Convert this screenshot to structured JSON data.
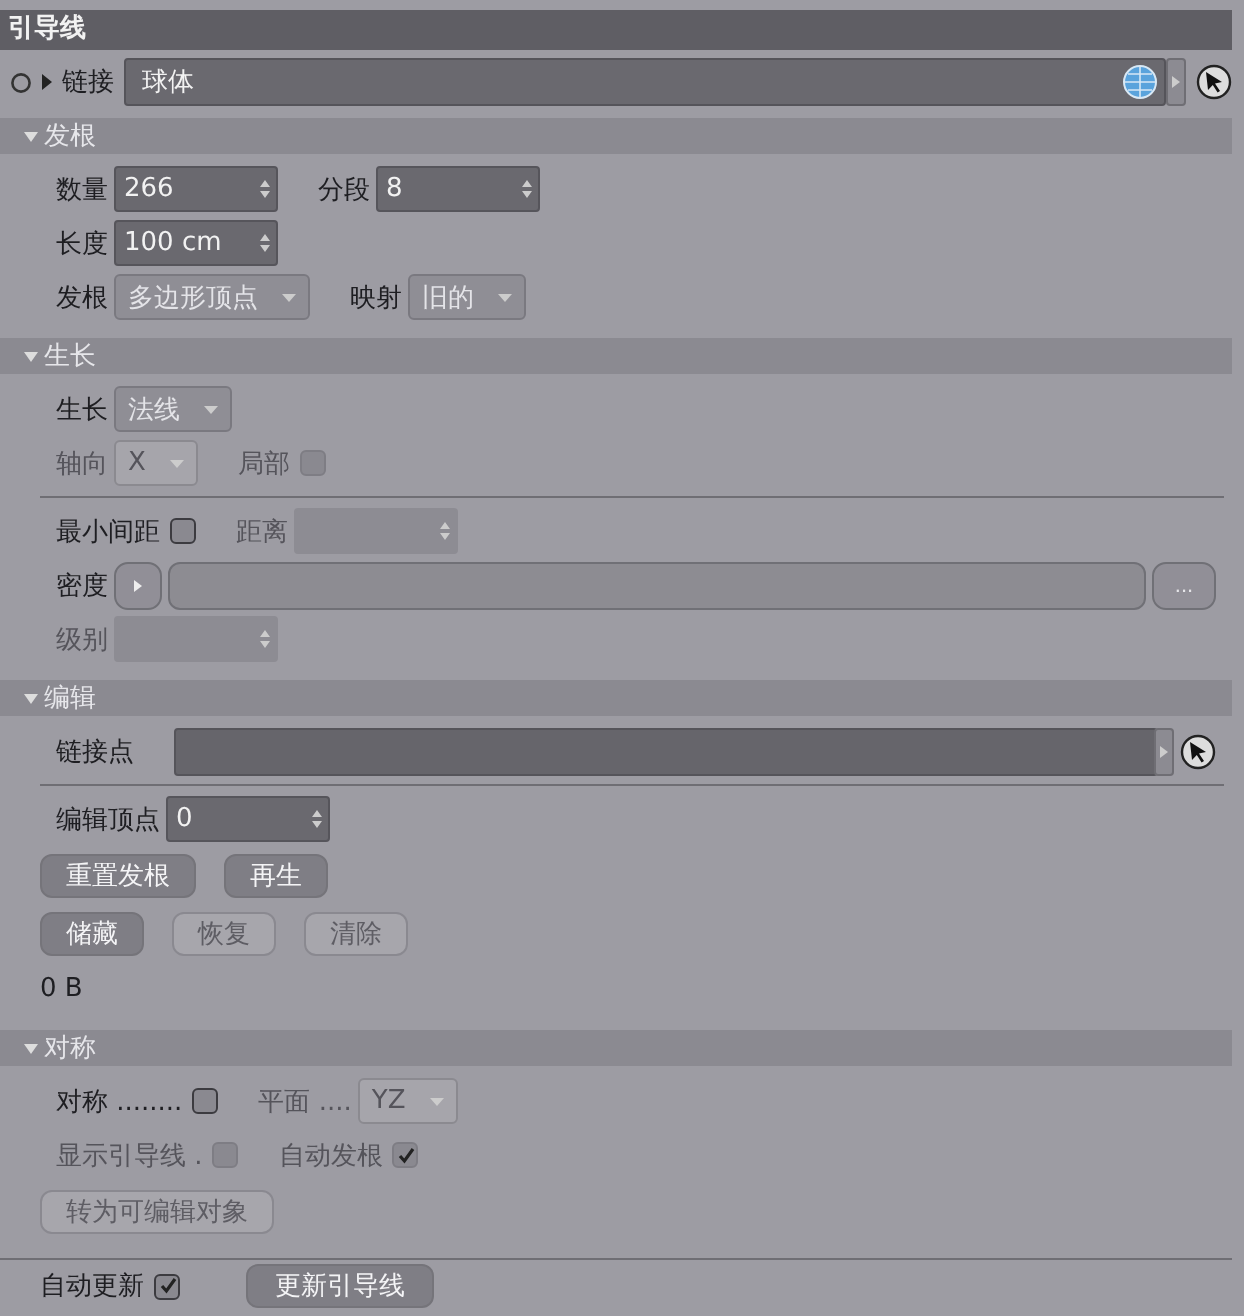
{
  "panel_title": "引导线",
  "link": {
    "label": "链接",
    "value": "球体"
  },
  "sections": [
    {
      "title": "发根",
      "expanded": true,
      "rows": [
        {
          "items": [
            {
              "kind": "number",
              "label": "数量",
              "value": "266",
              "disabled": false
            },
            {
              "kind": "number",
              "label": "分段",
              "value": "8",
              "disabled": false
            }
          ]
        },
        {
          "items": [
            {
              "kind": "number",
              "label": "长度",
              "value": "100 cm",
              "disabled": false
            }
          ]
        },
        {
          "items": [
            {
              "kind": "dropdown",
              "label": "发根",
              "value": "多边形顶点",
              "disabled": false
            },
            {
              "kind": "dropdown",
              "label": "映射",
              "value": "旧的",
              "disabled": false
            }
          ]
        }
      ]
    },
    {
      "title": "生长",
      "expanded": true,
      "rows": [
        {
          "items": [
            {
              "kind": "dropdown",
              "label": "生长",
              "value": "法线",
              "disabled": false
            }
          ]
        },
        {
          "items": [
            {
              "kind": "dropdown",
              "label": "轴向",
              "value": "X",
              "disabled": true
            },
            {
              "kind": "checkbox",
              "label": "局部",
              "checked": false,
              "disabled": true
            }
          ]
        },
        {
          "kind": "divider"
        },
        {
          "items": [
            {
              "kind": "checkbox",
              "label": "最小间距",
              "checked": false,
              "disabled": false
            },
            {
              "kind": "number",
              "label": "距离",
              "disabled": true
            }
          ]
        },
        {
          "items": [
            {
              "kind": "density",
              "label": "密度",
              "more": "...",
              "disabled": false
            }
          ]
        },
        {
          "items": [
            {
              "kind": "number",
              "label": "级别",
              "disabled": true
            }
          ]
        }
      ]
    },
    {
      "title": "编辑",
      "expanded": true,
      "rows": [
        {
          "items": [
            {
              "kind": "link",
              "label": "链接点",
              "disabled": false
            }
          ]
        },
        {
          "kind": "divider"
        },
        {
          "items": [
            {
              "kind": "number",
              "label": "编辑顶点",
              "value": "0",
              "disabled": false
            }
          ]
        },
        {
          "items": [
            {
              "kind": "button",
              "label": "重置发根",
              "disabled": false
            },
            {
              "kind": "button",
              "label": "再生",
              "disabled": false
            }
          ]
        },
        {
          "items": [
            {
              "kind": "button",
              "label": "储藏",
              "disabled": false
            },
            {
              "kind": "button",
              "label": "恢复",
              "disabled": true
            },
            {
              "kind": "button",
              "label": "清除",
              "disabled": true
            }
          ]
        },
        {
          "items": [
            {
              "kind": "text",
              "label": "0 B",
              "disabled": false
            }
          ]
        }
      ]
    },
    {
      "title": "对称",
      "expanded": true,
      "rows": [
        {
          "items": [
            {
              "kind": "checkbox",
              "label": "对称 ........",
              "checked": false,
              "disabled": false
            },
            {
              "kind": "dropdown",
              "label": "平面 ....",
              "value": "YZ",
              "disabled": true
            }
          ]
        },
        {
          "items": [
            {
              "kind": "checkbox",
              "label": "显示引导线 .",
              "checked": false,
              "disabled": true
            },
            {
              "kind": "checkbox",
              "label": "自动发根",
              "checked": true,
              "disabled": true
            }
          ]
        },
        {
          "items": [
            {
              "kind": "button",
              "label": "转为可编辑对象",
              "disabled": true
            }
          ]
        }
      ]
    }
  ],
  "footer": {
    "auto_update": {
      "label": "自动更新",
      "checked": true
    },
    "button": "更新引导线"
  }
}
